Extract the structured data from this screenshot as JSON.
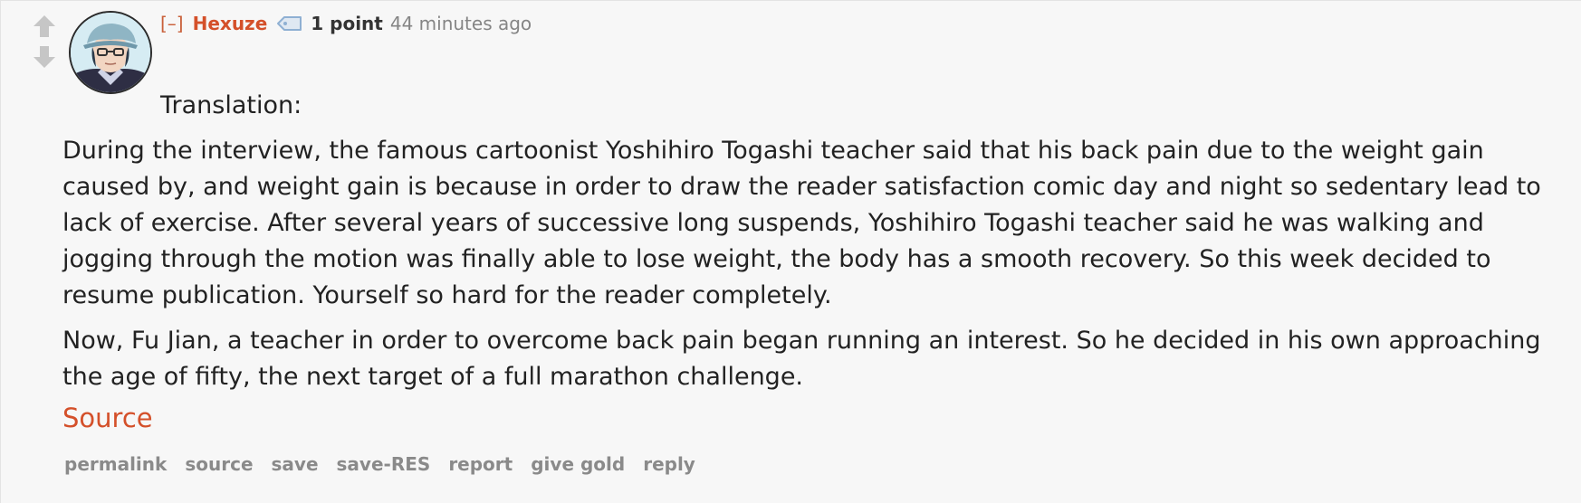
{
  "comment": {
    "collapse_label": "[–]",
    "author": "Hexuze",
    "score": "1 point",
    "time": "44 minutes ago",
    "paragraphs": [
      "Translation:",
      "During the interview, the famous cartoonist Yoshihiro Togashi teacher said that his back pain due to the weight gain caused by, and weight gain is because in order to draw the reader satisfaction comic day and night so sedentary lead to lack of exercise. After several years of successive long suspends, Yoshihiro Togashi teacher said he was walking and jogging through the motion was finally able to lose weight, the body has a smooth recovery. So this week decided to resume publication. Yourself so hard for the reader completely.",
      "Now, Fu Jian, a teacher in order to overcome back pain began running an interest. So he decided in his own approaching the age of fifty, the next target of a full marathon challenge."
    ],
    "source_link": "Source",
    "actions": {
      "permalink": "permalink",
      "source": "source",
      "save": "save",
      "save_res": "save-RES",
      "report": "report",
      "give_gold": "give gold",
      "reply": "reply"
    }
  },
  "icons": {
    "upvote": "upvote-arrow-icon",
    "downvote": "downvote-arrow-icon",
    "tag": "user-tag-icon"
  },
  "colors": {
    "author": "#d4502a",
    "link": "#d4502a",
    "muted": "#8a8a8a",
    "background": "#f7f7f7"
  }
}
